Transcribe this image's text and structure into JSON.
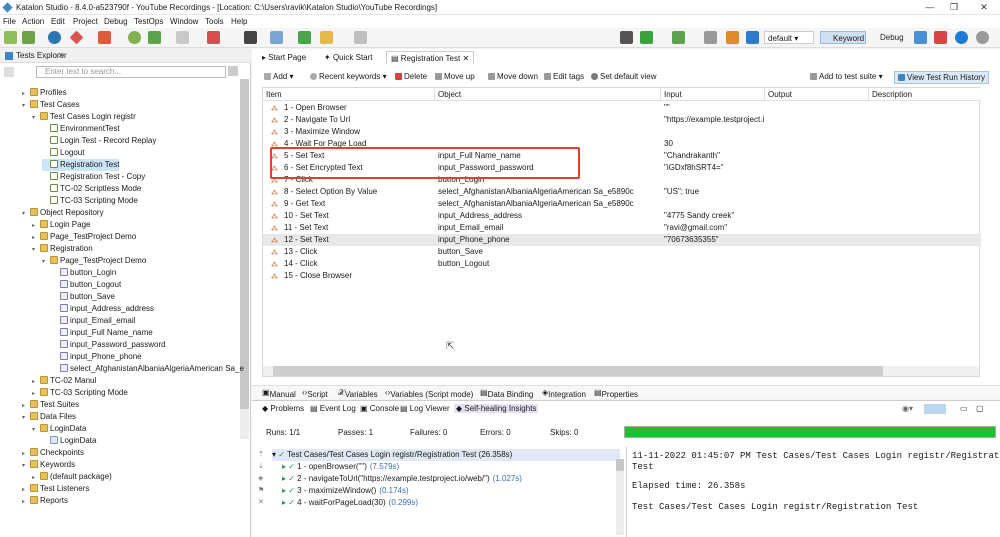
{
  "window": {
    "title": "Katalon Studio - 8.4.0-a523790f - YouTube Recordings - [Location: C:\\Users\\ravik\\Katalon Studio\\YouTube Recordings]"
  },
  "menu": [
    "File",
    "Action",
    "Edit",
    "Project",
    "Debug",
    "TestOps",
    "Window",
    "Tools",
    "Help"
  ],
  "toolbar": {
    "profile": "default",
    "keyword": "Keyword",
    "debug": "Debug"
  },
  "sidebar": {
    "title": "Tests Explorer",
    "filter_placeholder": "Enter text to search...",
    "tree": [
      {
        "label": "Profiles",
        "indent": 0,
        "type": "fold",
        "arrow": "▸"
      },
      {
        "label": "Test Cases",
        "indent": 0,
        "type": "fold",
        "arrow": "▾"
      },
      {
        "label": "Test Cases Login registr",
        "indent": 1,
        "type": "fold",
        "arrow": "▾"
      },
      {
        "label": "EnvironmentTest",
        "indent": 2,
        "type": "tcase",
        "arrow": ""
      },
      {
        "label": "Login Test - Record Replay",
        "indent": 2,
        "type": "tcase",
        "arrow": ""
      },
      {
        "label": "Logout",
        "indent": 2,
        "type": "tcase",
        "arrow": ""
      },
      {
        "label": "Registration Test",
        "indent": 2,
        "type": "tcase",
        "arrow": "",
        "selected": true
      },
      {
        "label": "Registration Test - Copy",
        "indent": 2,
        "type": "tcase",
        "arrow": ""
      },
      {
        "label": "TC-02 Scriptless Mode",
        "indent": 2,
        "type": "tcase",
        "arrow": ""
      },
      {
        "label": "TC-03 Scripting Mode",
        "indent": 2,
        "type": "tcase",
        "arrow": ""
      },
      {
        "label": "Object Repository",
        "indent": 0,
        "type": "fold",
        "arrow": "▾"
      },
      {
        "label": "Login Page",
        "indent": 1,
        "type": "fold",
        "arrow": "▸"
      },
      {
        "label": "Page_TestProject Demo",
        "indent": 1,
        "type": "fold",
        "arrow": "▸"
      },
      {
        "label": "Registration",
        "indent": 1,
        "type": "fold",
        "arrow": "▾"
      },
      {
        "label": "Page_TestProject Demo",
        "indent": 2,
        "type": "fold",
        "arrow": "▾"
      },
      {
        "label": "button_Login",
        "indent": 3,
        "type": "obj",
        "arrow": ""
      },
      {
        "label": "button_Logout",
        "indent": 3,
        "type": "obj",
        "arrow": ""
      },
      {
        "label": "button_Save",
        "indent": 3,
        "type": "obj",
        "arrow": ""
      },
      {
        "label": "input_Address_address",
        "indent": 3,
        "type": "obj",
        "arrow": ""
      },
      {
        "label": "input_Email_email",
        "indent": 3,
        "type": "obj",
        "arrow": ""
      },
      {
        "label": "input_Full Name_name",
        "indent": 3,
        "type": "obj",
        "arrow": ""
      },
      {
        "label": "input_Password_password",
        "indent": 3,
        "type": "obj",
        "arrow": ""
      },
      {
        "label": "input_Phone_phone",
        "indent": 3,
        "type": "obj",
        "arrow": ""
      },
      {
        "label": "select_AfghanistanAlbaniaAlgeriaAmerican Sa_e",
        "indent": 3,
        "type": "obj",
        "arrow": ""
      },
      {
        "label": "TC-02 Manul",
        "indent": 1,
        "type": "fold",
        "arrow": "▸"
      },
      {
        "label": "TC-03 Scripting Mode",
        "indent": 1,
        "type": "fold",
        "arrow": "▸"
      },
      {
        "label": "Test Suites",
        "indent": 0,
        "type": "fold",
        "arrow": "▸"
      },
      {
        "label": "Data Files",
        "indent": 0,
        "type": "fold",
        "arrow": "▾"
      },
      {
        "label": "LoginData",
        "indent": 1,
        "type": "fold",
        "arrow": "▾"
      },
      {
        "label": "LoginData",
        "indent": 2,
        "type": "file",
        "arrow": ""
      },
      {
        "label": "Checkpoints",
        "indent": 0,
        "type": "fold",
        "arrow": "▸"
      },
      {
        "label": "Keywords",
        "indent": 0,
        "type": "fold",
        "arrow": "▾"
      },
      {
        "label": "(default package)",
        "indent": 1,
        "type": "fold",
        "arrow": "▸"
      },
      {
        "label": "Test Listeners",
        "indent": 0,
        "type": "fold",
        "arrow": "▸"
      },
      {
        "label": "Reports",
        "indent": 0,
        "type": "fold",
        "arrow": "▸"
      }
    ]
  },
  "editor": {
    "tabs": [
      "Start Page",
      "Quick Start",
      "Registration Test"
    ],
    "toolbar": {
      "add": "Add",
      "recent": "Recent keywords",
      "delete": "Delete",
      "move_up": "Move up",
      "move_down": "Move down",
      "edit_tags": "Edit tags",
      "set_default_view": "Set default view",
      "add_to_suite": "Add to test suite",
      "view_history": "View Test Run History"
    },
    "columns": [
      "Item",
      "Object",
      "Input",
      "Output",
      "Description"
    ],
    "rows": [
      {
        "item": "1 - Open Browser",
        "object": "",
        "input": "\"\""
      },
      {
        "item": "2 - Navigate To Url",
        "object": "",
        "input": "\"https://example.testproject.i"
      },
      {
        "item": "3 - Maximize Window",
        "object": "",
        "input": ""
      },
      {
        "item": "4 - Wait For Page Load",
        "object": "",
        "input": "30"
      },
      {
        "item": "5 - Set Text",
        "object": "input_Full Name_name",
        "input": "\"Chandrakanth\""
      },
      {
        "item": "6 - Set Encrypted Text",
        "object": "input_Password_password",
        "input": "\"iGDxf8hSRT4=\""
      },
      {
        "item": "7 - Click",
        "object": "button_Login",
        "input": ""
      },
      {
        "item": "8 - Select Option By Value",
        "object": "select_AfghanistanAlbaniaAlgeriaAmerican Sa_e5890c",
        "input": "\"US\"; true"
      },
      {
        "item": "9 - Get Text",
        "object": "select_AfghanistanAlbaniaAlgeriaAmerican Sa_e5890c",
        "input": ""
      },
      {
        "item": "10 - Set Text",
        "object": "input_Address_address",
        "input": "\"4775 Sandy creek\""
      },
      {
        "item": "11 - Set Text",
        "object": "input_Email_email",
        "input": "\"ravi@gmail.com\""
      },
      {
        "item": "12 - Set Text",
        "object": "input_Phone_phone",
        "input": "\"70673635355\"",
        "highlight": true
      },
      {
        "item": "13 - Click",
        "object": "button_Save",
        "input": ""
      },
      {
        "item": "14 - Click",
        "object": "button_Logout",
        "input": ""
      },
      {
        "item": "15 - Close Browser",
        "object": "",
        "input": ""
      }
    ]
  },
  "view_tabs": [
    "Manual",
    "Script",
    "Variables",
    "Variables (Script mode)",
    "Data Binding",
    "Integration",
    "Properties"
  ],
  "console": {
    "tabs": [
      "Problems",
      "Event Log",
      "Console",
      "Log Viewer",
      "Self-healing Insights"
    ],
    "runs": "Runs: 1/1",
    "passes": "Passes: 1",
    "failures": "Failures: 0",
    "errors": "Errors: 0",
    "skips": "Skips: 0",
    "progress": 1.0,
    "log_root": "Test Cases/Test Cases Login registr/Registration Test (26.358s)",
    "log_items": [
      {
        "text": "1 - openBrowser(\"\")",
        "time": "(7.579s)"
      },
      {
        "text": "2 - navigateToUrl(\"https://example.testproject.io/web/\")",
        "time": "(1.027s)"
      },
      {
        "text": "3 - maximizeWindow()",
        "time": "(0.174s)"
      },
      {
        "text": "4 - waitForPageLoad(30)",
        "time": "(0.299s)"
      }
    ],
    "detail_line1": "11-11-2022 01:45:07 PM Test Cases/Test Cases Login registr/Registration",
    "detail_line2": "Test",
    "detail_elapsed": "Elapsed time: 26.358s",
    "detail_last": "Test Cases/Test Cases Login registr/Registration Test"
  },
  "colors": {
    "accent": "#3d86c6",
    "highlight_box": "#e0402f",
    "progress": "#1fbf2f"
  }
}
